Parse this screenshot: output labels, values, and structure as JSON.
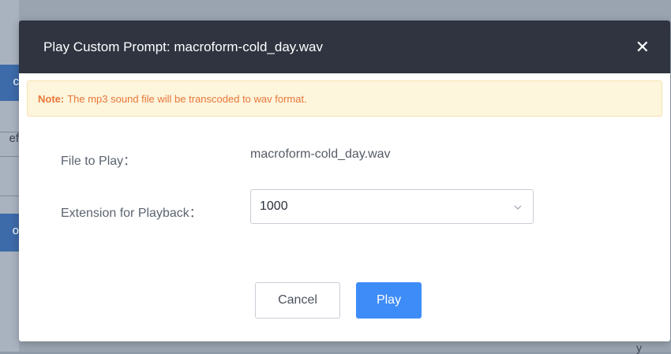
{
  "background": {
    "fragments": [
      "c",
      "ef",
      "o"
    ],
    "bottom_fragment": "y"
  },
  "dialog": {
    "title": "Play Custom Prompt: macroform-cold_day.wav",
    "close_icon": "close-icon",
    "note": {
      "label": "Note:",
      "text": "The mp3 sound file will be transcoded to wav format."
    },
    "file_to_play": {
      "label": "File to Play：",
      "value": "macroform-cold_day.wav"
    },
    "extension": {
      "label": "Extension for Playback：",
      "value": "1000",
      "chevron_icon": "chevron-down-icon"
    },
    "buttons": {
      "cancel": "Cancel",
      "play": "Play"
    }
  },
  "colors": {
    "header_bg": "#2f3440",
    "note_bg": "#fdf5dc",
    "note_text": "#e8773a",
    "primary": "#3e8cf7"
  }
}
